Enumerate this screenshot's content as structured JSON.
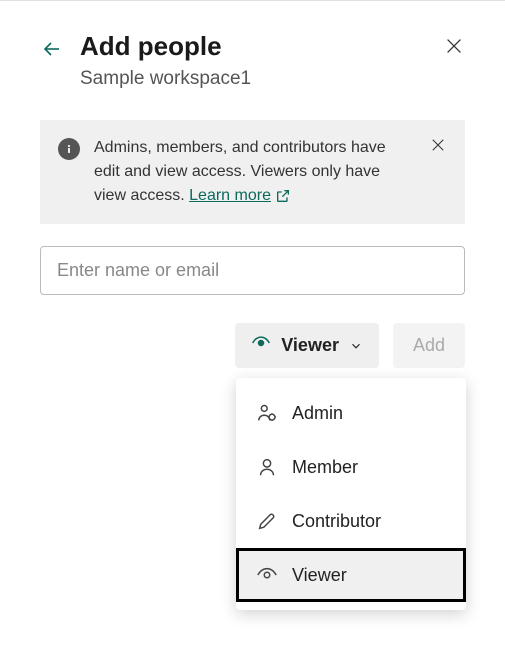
{
  "header": {
    "title": "Add people",
    "subtitle": "Sample workspace1"
  },
  "banner": {
    "text_part1": "Admins, members, and contributors have edit and view access. Viewers only have view access. ",
    "learn_more": "Learn more "
  },
  "input": {
    "placeholder": "Enter name or email"
  },
  "actions": {
    "role_selected": "Viewer",
    "add_label": "Add"
  },
  "roles": {
    "admin": "Admin",
    "member": "Member",
    "contributor": "Contributor",
    "viewer": "Viewer"
  }
}
